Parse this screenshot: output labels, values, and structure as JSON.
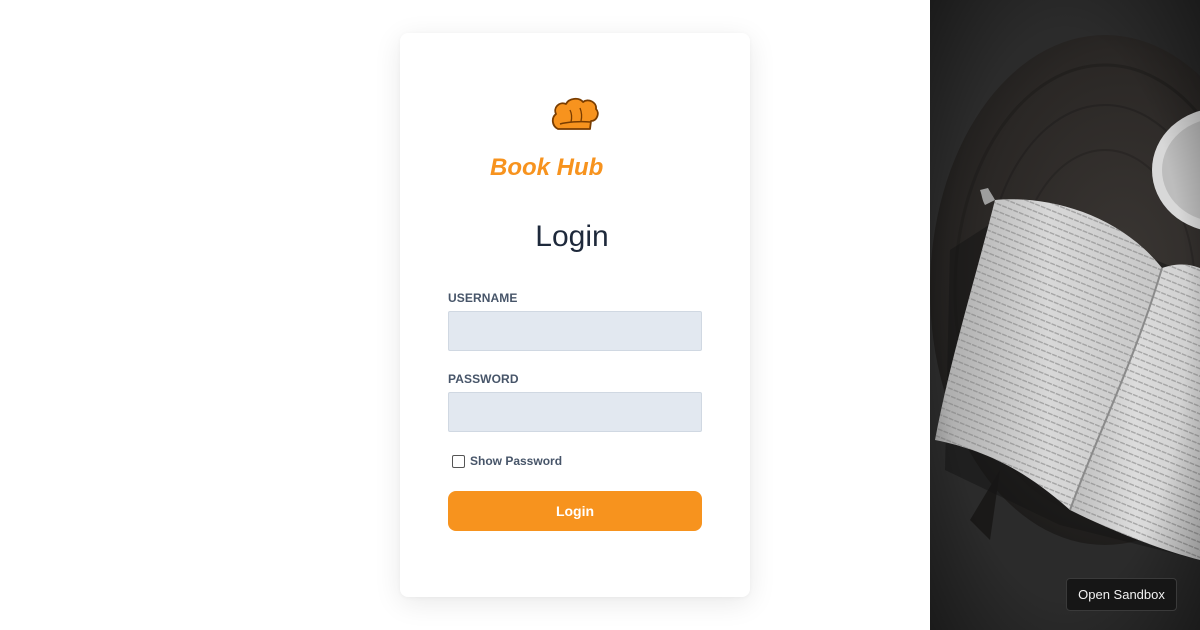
{
  "brand": {
    "name": "Book Hub",
    "icon": "chef-hat-icon",
    "color": "#f7931e"
  },
  "form": {
    "heading": "Login",
    "username_label": "USERNAME",
    "username_value": "",
    "password_label": "PASSWORD",
    "password_value": "",
    "show_password_label": "Show Password",
    "show_password_checked": false,
    "submit_label": "Login",
    "input_bg": "#e2e8f0"
  },
  "side_panel": {
    "image": "open-book-on-wooden-stump-photo",
    "sandbox_button_label": "Open Sandbox"
  }
}
